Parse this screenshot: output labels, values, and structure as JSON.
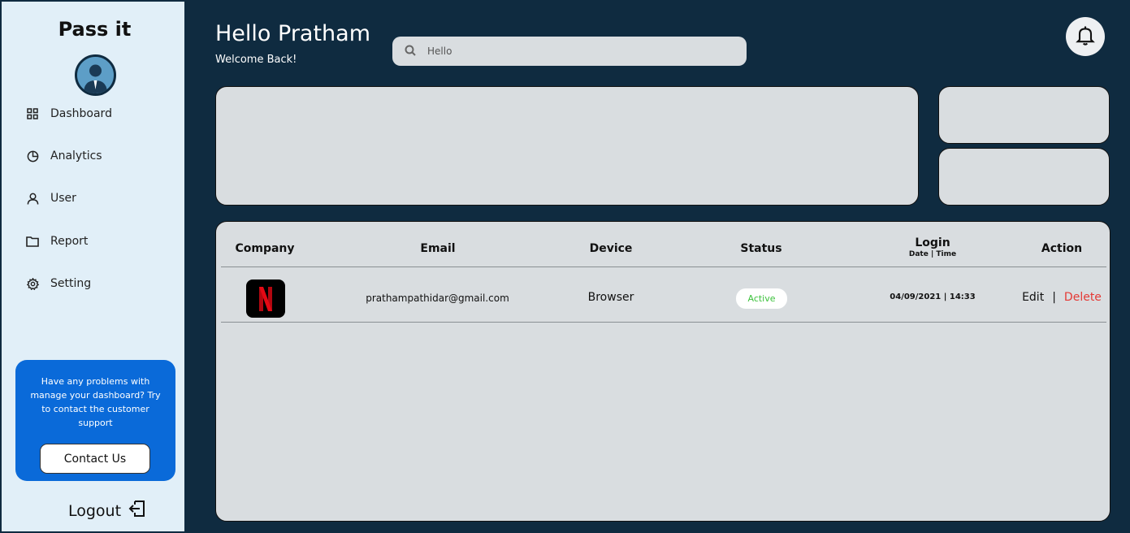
{
  "brand": "Pass it",
  "sidebar": {
    "items": [
      {
        "label": "Dashboard",
        "icon": "grid-icon"
      },
      {
        "label": "Analytics",
        "icon": "pie-chart-icon"
      },
      {
        "label": "User",
        "icon": "user-icon"
      },
      {
        "label": "Report",
        "icon": "folder-icon"
      },
      {
        "label": "Setting",
        "icon": "gear-icon"
      }
    ],
    "support_text": "Have any problems with manage your dashboard? Try to contact the customer support",
    "contact_label": "Contact Us",
    "logout_label": "Logout"
  },
  "header": {
    "greeting": "Hello Pratham",
    "welcome": "Welcome Back!",
    "search_value": "Hello"
  },
  "table": {
    "headers": {
      "company": "Company",
      "email": "Email",
      "device": "Device",
      "status": "Status",
      "login": "Login",
      "login_sub": "Date | Time",
      "action": "Action"
    },
    "rows": [
      {
        "company_logo": "netflix-logo",
        "email": "prathampathidar@gmail.com",
        "device": "Browser",
        "status": "Active",
        "login": "04/09/2021 | 14:33",
        "edit": "Edit",
        "separator": "|",
        "delete": "Delete"
      }
    ]
  },
  "colors": {
    "background": "#0f2b40",
    "sidebar": "#e1eff8",
    "card": "#d9dde0",
    "support": "#0a6ad9",
    "status_active": "#3cc23c",
    "delete": "#e53935"
  }
}
